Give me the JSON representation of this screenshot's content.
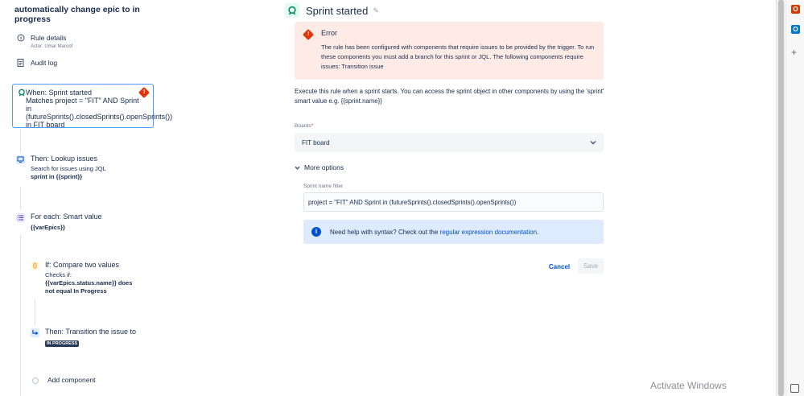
{
  "rule": {
    "title": "automatically change epic to in progress",
    "details_label": "Rule details",
    "actor": "Actor: Umar Maroof",
    "audit_label": "Audit log"
  },
  "steps": {
    "trigger": {
      "title": "When: Sprint started",
      "desc": "Matches project = \"FIT\" AND Sprint in (futureSprints().closedSprints().openSprints()) in FIT board"
    },
    "lookup": {
      "title": "Then: Lookup issues",
      "desc": "Search for issues using JQL",
      "bold": "sprint in {{sprint}}"
    },
    "foreach": {
      "title": "For each: Smart value",
      "bold": "{{varEpics}}"
    },
    "compare": {
      "title": "If: Compare two values",
      "desc": "Checks if:",
      "bold": "{{varEpics.status.name}} does not equal In Progress"
    },
    "transition": {
      "title": "Then: Transition the issue to",
      "status": "IN PROGRESS"
    },
    "add_label": "Add component"
  },
  "panel": {
    "title": "Sprint started",
    "error_title": "Error",
    "error_body": "The rule has been configured with components that require issues to be provided by the trigger. To run these components you must add a branch for this sprint or JQL. The following components require issues: Transition issue",
    "description": "Execute this rule when a sprint starts. You can access the sprint object in other components by using the 'sprint' smart value e.g. {{sprint.name}}",
    "boards_label": "Boards",
    "boards_value": "FIT board",
    "more_options": "More options",
    "sprint_filter_label": "Sprint name filter",
    "sprint_filter_value": "project = \"FIT\" AND Sprint in (futureSprints().closedSprints().openSprints())",
    "info_text": "Need help with syntax? Check out the ",
    "info_link": "regular expression documentation",
    "info_end": ".",
    "cancel": "Cancel",
    "save": "Save"
  },
  "os": {
    "watermark": "Activate Windows"
  },
  "icons": [
    "info-icon",
    "document-icon",
    "sprint-trigger-icon",
    "warning-icon",
    "lookup-icon",
    "list-icon",
    "braces-icon",
    "transition-icon",
    "edit-pencil-icon",
    "chevron-down-icon",
    "office-icon",
    "outlook-icon",
    "plus-icon"
  ],
  "colors": {
    "brand": "#0052cc",
    "error": "#de350b",
    "success": "#00875a",
    "error_bg": "#ffebe6",
    "info_bg": "#deebff"
  }
}
